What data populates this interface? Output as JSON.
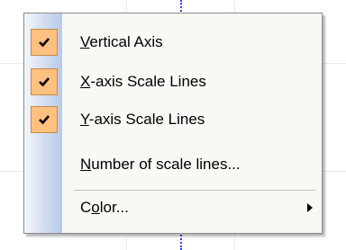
{
  "menu": {
    "items": [
      {
        "accel": "V",
        "rest": "ertical Axis",
        "checked": true
      },
      {
        "accel": "X",
        "rest": "-axis Scale Lines",
        "checked": true
      },
      {
        "accel": "Y",
        "rest": "-axis Scale Lines",
        "checked": true
      },
      {
        "accel": "N",
        "rest": "umber of scale lines...",
        "checked": false
      }
    ],
    "color_item": {
      "pre": "C",
      "accel": "o",
      "rest": "lor...",
      "has_submenu": true
    }
  },
  "colors": {
    "check_bg": "#ffc080",
    "check_border": "#c48a4a",
    "menu_bg": "#f9f8f4",
    "gutter": "#c9d6ee",
    "axis_line": "#2a3cff"
  },
  "icons": {
    "check": "check-icon",
    "submenu": "chevron-right-icon"
  }
}
